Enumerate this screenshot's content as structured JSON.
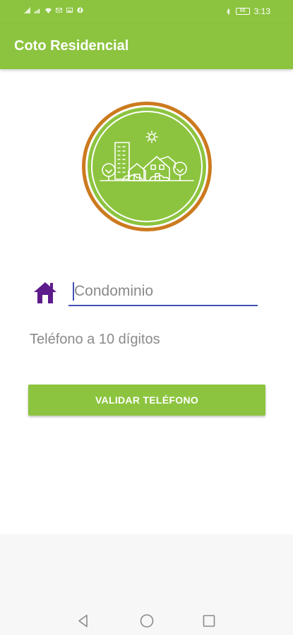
{
  "status_bar": {
    "left_icons": [
      "signal-icon",
      "wifi-icon",
      "mail-icon",
      "image-icon",
      "facebook-icon"
    ],
    "bluetooth": "bluetooth-icon",
    "battery": "88",
    "time": "3:13"
  },
  "app_bar": {
    "title": "Coto Residencial"
  },
  "logo": {
    "name": "residential-logo",
    "colors": {
      "ring_outer": "#cc7a1e",
      "circle": "#8cc43f",
      "lines": "#ffffff"
    }
  },
  "form": {
    "condominio": {
      "placeholder": "Condominio",
      "value": "",
      "icon": "home-icon",
      "icon_color": "#5e1b8c",
      "underline_color": "#3f51b5"
    },
    "phone_label": "Teléfono a 10 dígitos",
    "validate_button": "VALIDAR TELÉFONO"
  },
  "nav_bar": {
    "back": "back-icon",
    "home": "home-circle-icon",
    "recents": "recents-icon"
  },
  "colors": {
    "primary": "#8cc43f",
    "text_muted": "#8a8a8a"
  }
}
